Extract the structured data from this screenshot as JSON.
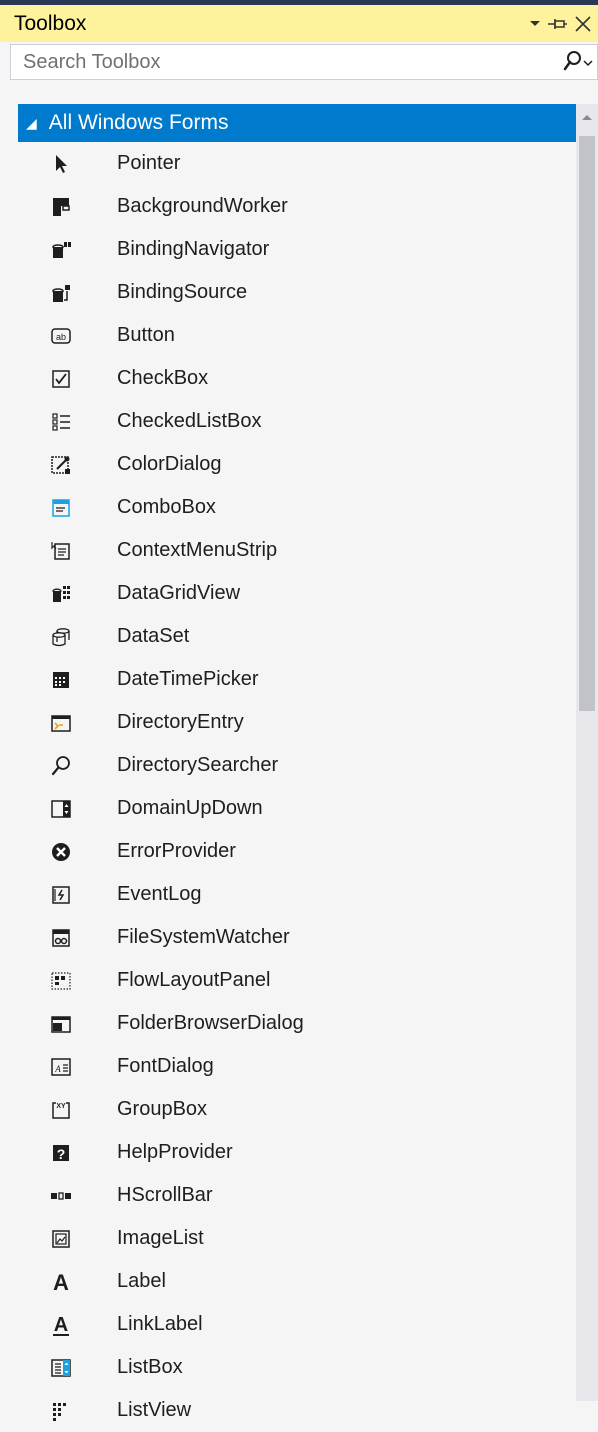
{
  "window": {
    "title": "Toolbox"
  },
  "search": {
    "placeholder": "Search Toolbox"
  },
  "group": {
    "label": "All Windows Forms",
    "expanded": true
  },
  "items": [
    {
      "label": "Pointer",
      "icon": "pointer-icon"
    },
    {
      "label": "BackgroundWorker",
      "icon": "background-worker-icon"
    },
    {
      "label": "BindingNavigator",
      "icon": "binding-navigator-icon"
    },
    {
      "label": "BindingSource",
      "icon": "binding-source-icon"
    },
    {
      "label": "Button",
      "icon": "button-icon"
    },
    {
      "label": "CheckBox",
      "icon": "checkbox-icon"
    },
    {
      "label": "CheckedListBox",
      "icon": "checked-list-box-icon"
    },
    {
      "label": "ColorDialog",
      "icon": "color-dialog-icon"
    },
    {
      "label": "ComboBox",
      "icon": "combobox-icon"
    },
    {
      "label": "ContextMenuStrip",
      "icon": "context-menu-strip-icon"
    },
    {
      "label": "DataGridView",
      "icon": "data-grid-view-icon"
    },
    {
      "label": "DataSet",
      "icon": "dataset-icon"
    },
    {
      "label": "DateTimePicker",
      "icon": "date-time-picker-icon"
    },
    {
      "label": "DirectoryEntry",
      "icon": "directory-entry-icon"
    },
    {
      "label": "DirectorySearcher",
      "icon": "directory-searcher-icon"
    },
    {
      "label": "DomainUpDown",
      "icon": "domain-up-down-icon"
    },
    {
      "label": "ErrorProvider",
      "icon": "error-provider-icon"
    },
    {
      "label": "EventLog",
      "icon": "event-log-icon"
    },
    {
      "label": "FileSystemWatcher",
      "icon": "file-system-watcher-icon"
    },
    {
      "label": "FlowLayoutPanel",
      "icon": "flow-layout-panel-icon"
    },
    {
      "label": "FolderBrowserDialog",
      "icon": "folder-browser-dialog-icon"
    },
    {
      "label": "FontDialog",
      "icon": "font-dialog-icon"
    },
    {
      "label": "GroupBox",
      "icon": "group-box-icon"
    },
    {
      "label": "HelpProvider",
      "icon": "help-provider-icon"
    },
    {
      "label": "HScrollBar",
      "icon": "hscrollbar-icon"
    },
    {
      "label": "ImageList",
      "icon": "image-list-icon"
    },
    {
      "label": "Label",
      "icon": "label-icon"
    },
    {
      "label": "LinkLabel",
      "icon": "link-label-icon"
    },
    {
      "label": "ListBox",
      "icon": "listbox-icon"
    },
    {
      "label": "ListView",
      "icon": "listview-icon"
    }
  ],
  "colors": {
    "title_bar": "#fff29d",
    "selection": "#007acc",
    "background": "#f5f5f5",
    "icon_accent": "#1ba1e2"
  }
}
